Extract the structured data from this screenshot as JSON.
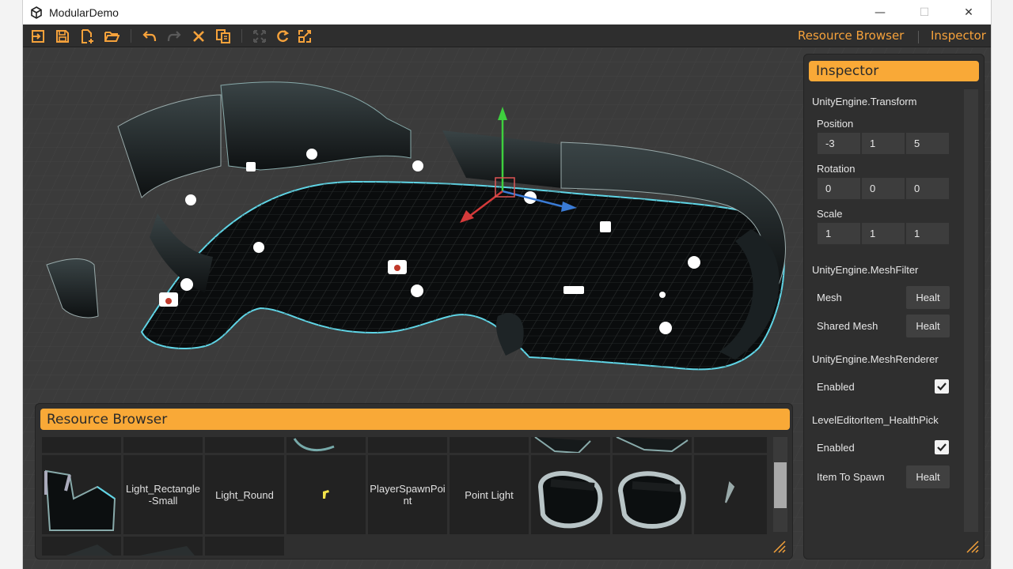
{
  "window": {
    "title": "ModularDemo",
    "controls": {
      "minimize": "—",
      "maximize": "☐",
      "close": "✕"
    }
  },
  "toolbar": {
    "buttons": [
      {
        "icon": "exit-icon",
        "name": "exit"
      },
      {
        "icon": "save-icon",
        "name": "save"
      },
      {
        "icon": "new-file-icon",
        "name": "new"
      },
      {
        "icon": "open-folder-icon",
        "name": "open"
      },
      {
        "icon": "undo-icon",
        "name": "undo"
      },
      {
        "icon": "redo-icon",
        "name": "redo"
      },
      {
        "icon": "delete-icon",
        "name": "delete"
      },
      {
        "icon": "duplicate-icon",
        "name": "duplicate"
      },
      {
        "icon": "move-icon",
        "name": "move"
      },
      {
        "icon": "rotate-icon",
        "name": "rotate"
      },
      {
        "icon": "scale-icon",
        "name": "scale"
      }
    ],
    "links": {
      "resource_browser": "Resource Browser",
      "inspector": "Inspector"
    },
    "accent": "#f6a23b"
  },
  "inspector": {
    "title": "Inspector",
    "transform": {
      "section": "UnityEngine.Transform",
      "position_label": "Position",
      "position": [
        "-3",
        "1",
        "5"
      ],
      "rotation_label": "Rotation",
      "rotation": [
        "0",
        "0",
        "0"
      ],
      "scale_label": "Scale",
      "scale": [
        "1",
        "1",
        "1"
      ]
    },
    "mesh_filter": {
      "section": "UnityEngine.MeshFilter",
      "mesh_label": "Mesh",
      "mesh_value": "Healt",
      "shared_mesh_label": "Shared Mesh",
      "shared_mesh_value": "Healt"
    },
    "mesh_renderer": {
      "section": "UnityEngine.MeshRenderer",
      "enabled_label": "Enabled",
      "enabled": true
    },
    "level_editor_item": {
      "section": "LevelEditorItem_HealthPick",
      "enabled_label": "Enabled",
      "enabled": true,
      "item_to_spawn_label": "Item To Spawn",
      "item_to_spawn_value": "Healt"
    }
  },
  "resource_browser": {
    "title": "Resource Browser",
    "items": [
      {
        "label": "",
        "thumb": "mesh"
      },
      {
        "label": "Light_Rectangle-Small",
        "thumb": "text"
      },
      {
        "label": "Light_Round",
        "thumb": "text"
      },
      {
        "label": "",
        "thumb": "pistol-icon"
      },
      {
        "label": "PlayerSpawnPoint",
        "thumb": "text"
      },
      {
        "label": "Point Light",
        "thumb": "text"
      },
      {
        "label": "",
        "thumb": "mesh"
      },
      {
        "label": "",
        "thumb": "mesh"
      },
      {
        "label": "",
        "thumb": "mesh"
      }
    ],
    "cell_lines": {
      "light_rect": [
        "Light_Rectangle",
        "-Small"
      ],
      "player_spawn": [
        "PlayerSpawnPoi",
        "nt"
      ]
    }
  }
}
